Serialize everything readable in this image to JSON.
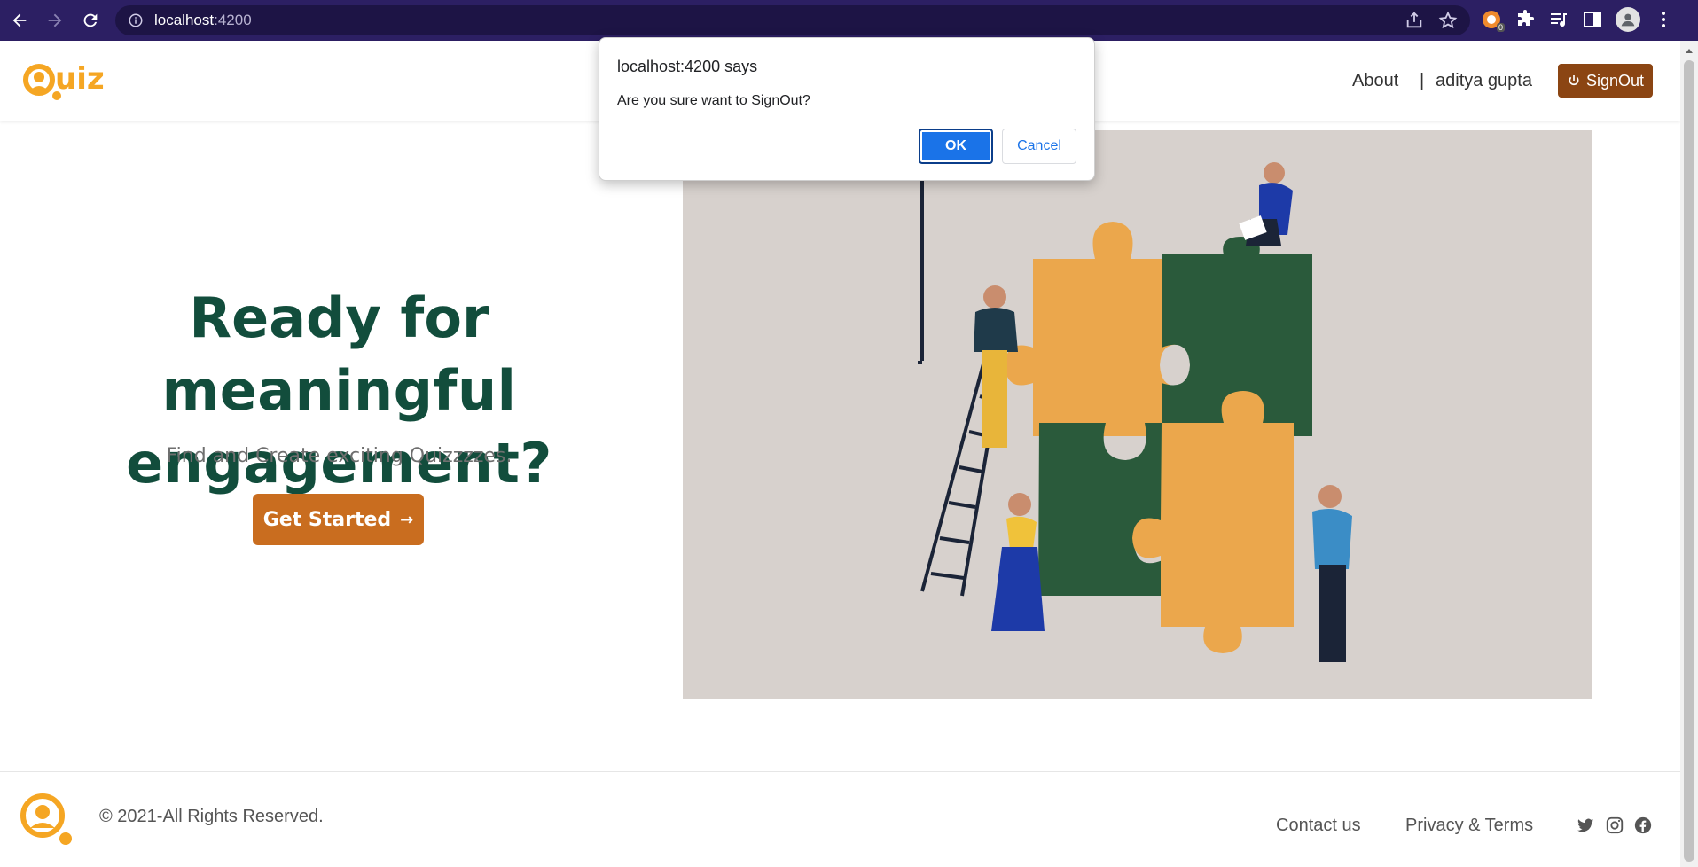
{
  "browser": {
    "url_host": "localhost",
    "url_port": ":4200",
    "icons": [
      "back-icon",
      "forward-icon",
      "reload-icon",
      "info-icon",
      "share-icon",
      "star-icon",
      "extension-badge-icon",
      "puzzle-icon",
      "media-icon",
      "sidepanel-icon",
      "profile-icon",
      "menu-icon"
    ],
    "extension_badge": "0"
  },
  "header": {
    "logo_text": "Quiz",
    "nav_about": "About",
    "nav_separator": "|",
    "user_name": "aditya gupta",
    "signout_label": "SignOut"
  },
  "hero": {
    "title_line1": "Ready for",
    "title_line2": "meaningful engagement?",
    "subtitle": "Find and Create exciting Quizzzzes.",
    "cta_label": "Get Started",
    "cta_arrow": "→"
  },
  "footer": {
    "copyright": "© 2021-All Rights Reserved.",
    "links": [
      "Contact us",
      "Privacy & Terms"
    ],
    "social": [
      "twitter-icon",
      "instagram-icon",
      "facebook-icon"
    ]
  },
  "dialog": {
    "title": "localhost:4200 says",
    "message": "Are you sure want to SignOut?",
    "ok_label": "OK",
    "cancel_label": "Cancel"
  },
  "colors": {
    "chrome_bg": "#2c1f63",
    "brand_orange": "#f5a623",
    "title_green": "#124d3c",
    "cta": "#c96d1f",
    "signout": "#8b4513",
    "dialog_ok": "#1a73e8"
  }
}
